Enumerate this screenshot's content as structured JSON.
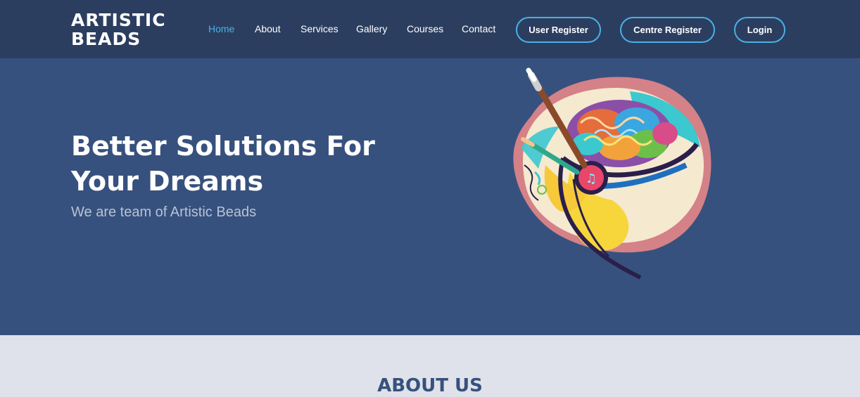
{
  "header": {
    "logo_text": "ARTISTIC\nBEADS",
    "nav": [
      {
        "label": "Home",
        "active": true
      },
      {
        "label": "About"
      },
      {
        "label": "Services"
      },
      {
        "label": "Gallery"
      },
      {
        "label": "Courses"
      },
      {
        "label": "Contact"
      }
    ],
    "buttons": {
      "user_register": "User Register",
      "centre_register": "Centre Register",
      "login": "Login"
    }
  },
  "hero": {
    "title": "Better Solutions For Your Dreams",
    "subtitle": "We are team of Artistic Beads",
    "illustration_icon": "colorful-brain-head-art-icon"
  },
  "about": {
    "title": "ABOUT US"
  },
  "colors": {
    "navbar": "#2c3e60",
    "hero": "#37517e",
    "accent": "#47b2e4",
    "section_bg": "#dfe2ea"
  }
}
